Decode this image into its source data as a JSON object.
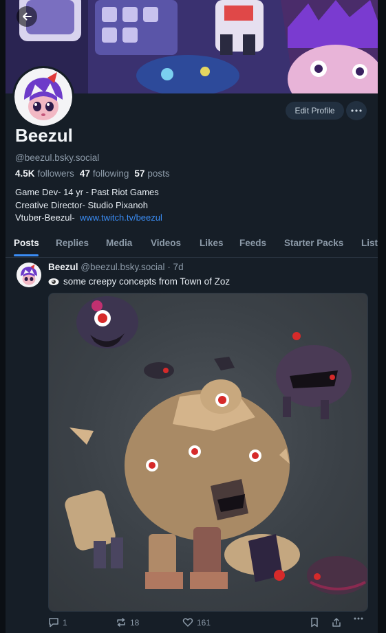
{
  "profile": {
    "display_name": "Beezul",
    "handle": "@beezul.bsky.social",
    "followers_count": "4.5K",
    "followers_label": "followers",
    "following_count": "47",
    "following_label": "following",
    "posts_count": "57",
    "posts_label": "posts",
    "bio_line1": "Game Dev- 14 yr - Past Riot Games",
    "bio_line2": "Creative Director- Studio Pixanoh",
    "bio_line3_prefix": "Vtuber-Beezul-",
    "bio_link": "www.twitch.tv/beezul"
  },
  "buttons": {
    "edit_profile": "Edit Profile"
  },
  "tabs": [
    {
      "label": "Posts",
      "active": true
    },
    {
      "label": "Replies"
    },
    {
      "label": "Media"
    },
    {
      "label": "Videos"
    },
    {
      "label": "Likes"
    },
    {
      "label": "Feeds"
    },
    {
      "label": "Starter Packs"
    },
    {
      "label": "List"
    }
  ],
  "post": {
    "author": "Beezul",
    "handle": "@beezul.bsky.social",
    "time": "· 7d",
    "text": "some creepy concepts from Town of Zoz",
    "text_icon": "eye-emoji",
    "reply_count": "1",
    "repost_count": "18",
    "like_count": "161"
  },
  "colors": {
    "background": "#161e27",
    "accent": "#3b8df5",
    "muted": "#8c9aa8"
  }
}
